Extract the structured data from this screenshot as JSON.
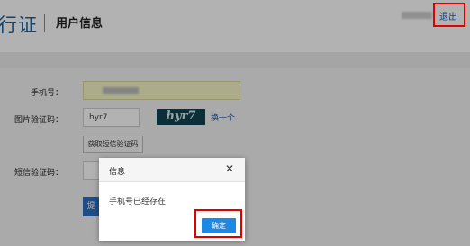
{
  "header": {
    "brand": "行证",
    "page_title": "用户信息",
    "logout_label": "退出"
  },
  "form": {
    "phone_label": "手机号：",
    "captcha_label": "图片验证码：",
    "captcha_value": "hyr7",
    "captcha_image_text": "hyr7",
    "refresh_link": "换一个",
    "sms_button": "获取短信验证码",
    "sms_label": "短信验证码：",
    "submit_label": "提"
  },
  "dialog": {
    "title": "信息",
    "message": "手机号已经存在",
    "ok_label": "确定"
  },
  "colors": {
    "brand": "#1a63a6",
    "primary_button": "#1e88e5",
    "highlight": "#e00000"
  }
}
